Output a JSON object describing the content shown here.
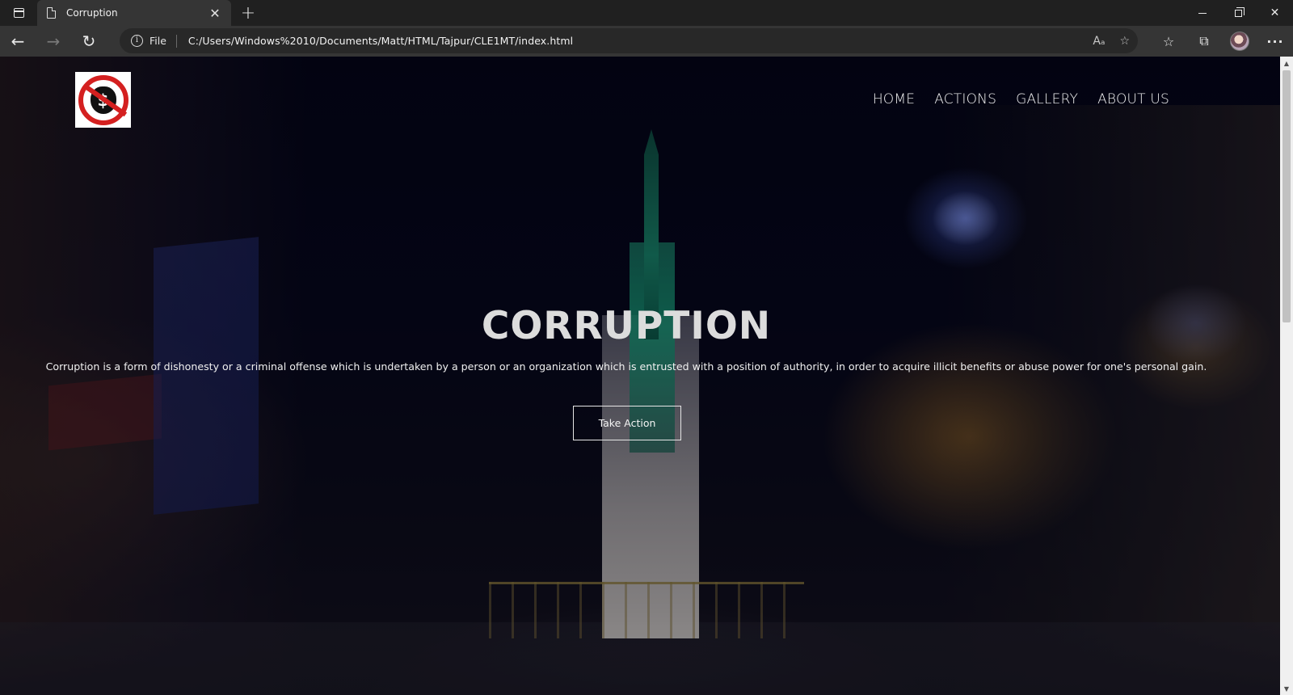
{
  "browser": {
    "tab": {
      "title": "Corruption",
      "close_glyph": "✕"
    },
    "new_tab_glyph": "+",
    "window_controls": {
      "close_glyph": "✕"
    },
    "address_bar": {
      "scheme_label": "File",
      "url": "C:/Users/Windows%2010/Documents/Matt/HTML/Tajpur/CLE1MT/index.html",
      "read_aloud_glyph": "Aₐ",
      "add_favorite_glyph": "☆"
    },
    "nav": {
      "back_glyph": "←",
      "forward_glyph": "→",
      "refresh_glyph": "↻"
    },
    "toolbar": {
      "favorites_glyph": "☆",
      "collections_glyph": "⧉",
      "menu_glyph": "···"
    },
    "icons": [
      "tab-actions-icon",
      "page-icon",
      "info-icon",
      "read-aloud-icon",
      "add-favorite-icon",
      "favorites-icon",
      "collections-icon",
      "profile-avatar",
      "more-menu-icon"
    ]
  },
  "site": {
    "logo_glyph": "$",
    "nav": [
      {
        "label": "HOME"
      },
      {
        "label": "ACTIONS"
      },
      {
        "label": "GALLERY"
      },
      {
        "label": "ABOUT US"
      }
    ],
    "hero": {
      "title": "CORRUPTION",
      "description": "Corruption is a form of dishonesty or a criminal offense which is undertaken by a person or an organization which is entrusted with a position of authority, in order to acquire illicit benefits or abuse power for one's personal gain.",
      "cta_label": "Take Action"
    }
  },
  "colors": {
    "chrome_dark": "#202020",
    "chrome_toolbar": "#353535",
    "logo_red": "#d42020",
    "hero_title": "#dcdcdc"
  }
}
